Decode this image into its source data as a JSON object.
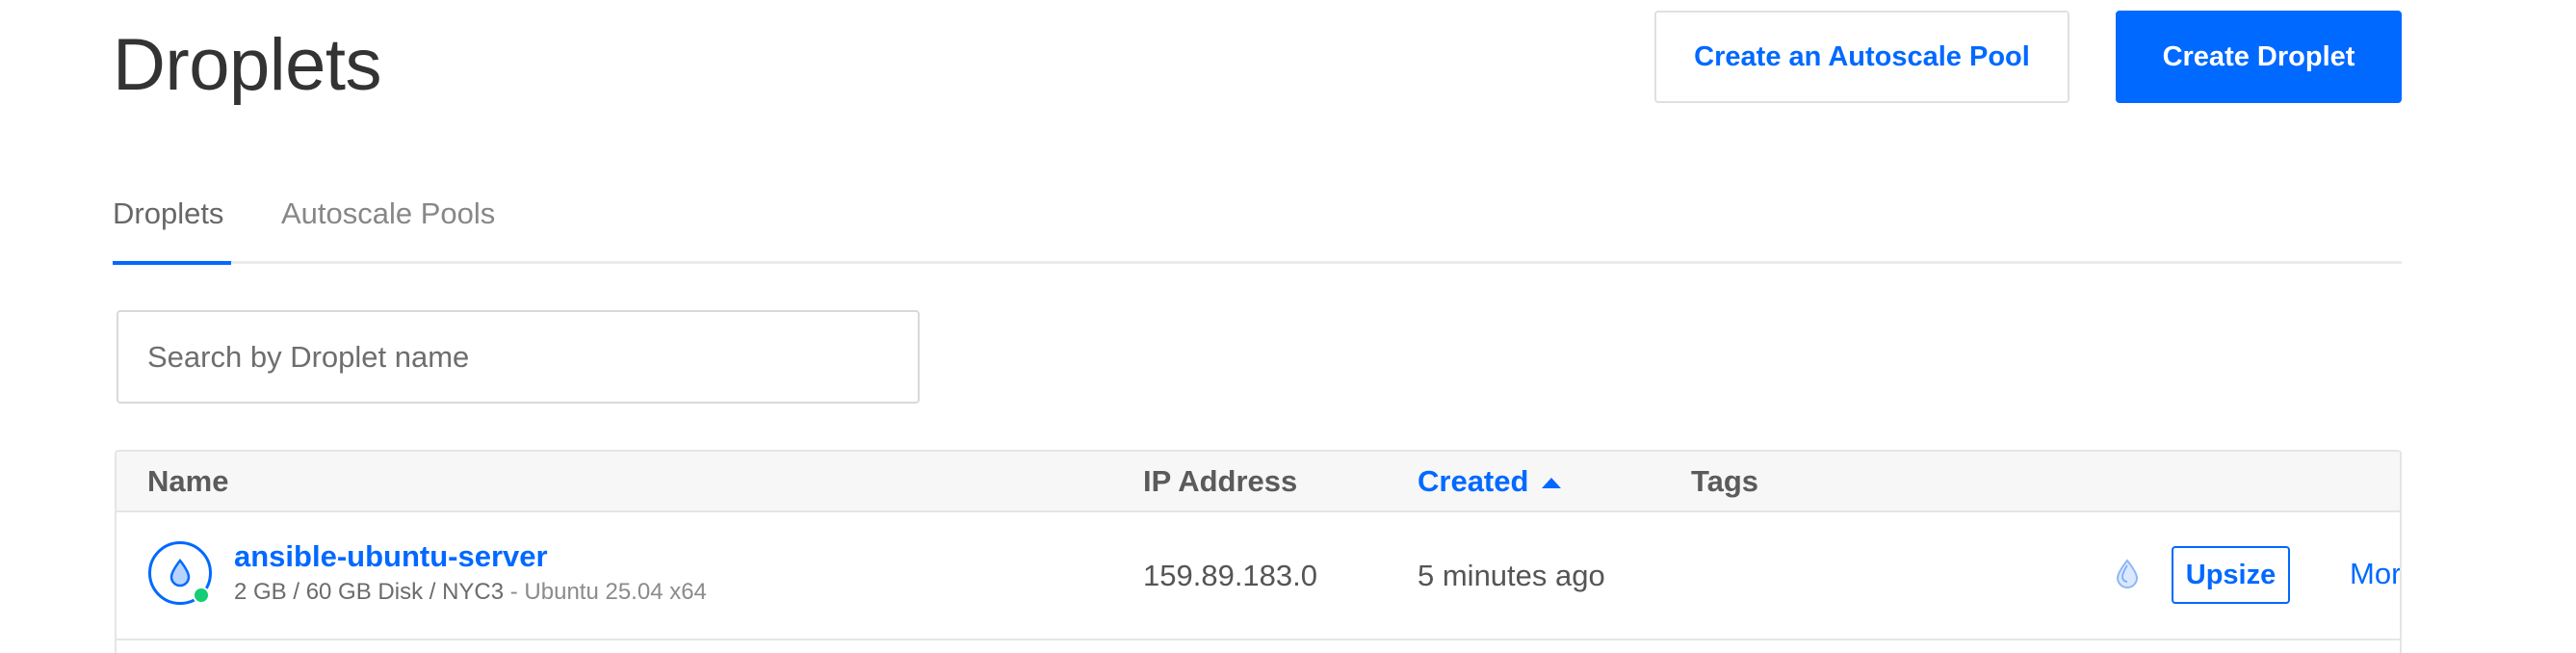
{
  "page": {
    "title": "Droplets"
  },
  "header_actions": {
    "autoscale_button": "Create an Autoscale Pool",
    "create_button": "Create Droplet"
  },
  "tabs": [
    {
      "label": "Droplets",
      "active": true
    },
    {
      "label": "Autoscale Pools",
      "active": false
    }
  ],
  "search": {
    "placeholder": "Search by Droplet name",
    "value": ""
  },
  "table": {
    "columns": [
      {
        "label": "Name"
      },
      {
        "label": "IP Address"
      },
      {
        "label": "Created",
        "sorted": "ascending"
      },
      {
        "label": "Tags"
      }
    ],
    "rows": [
      {
        "name": "ansible-ubuntu-server",
        "specs": "2 GB / 60 GB Disk / NYC3",
        "os": " - Ubuntu 25.04 x64",
        "ip": "159.89.183.0",
        "created": "5 minutes ago",
        "tags": "",
        "status": "running",
        "upsize_label": "Upsize",
        "more_label": "More"
      }
    ]
  },
  "colors": {
    "accent": "#0069ff",
    "status_active": "#15cd72"
  },
  "icons": [
    "droplet-icon",
    "sort-ascending-icon",
    "droplet-outline-icon",
    "chevron-down-icon"
  ]
}
